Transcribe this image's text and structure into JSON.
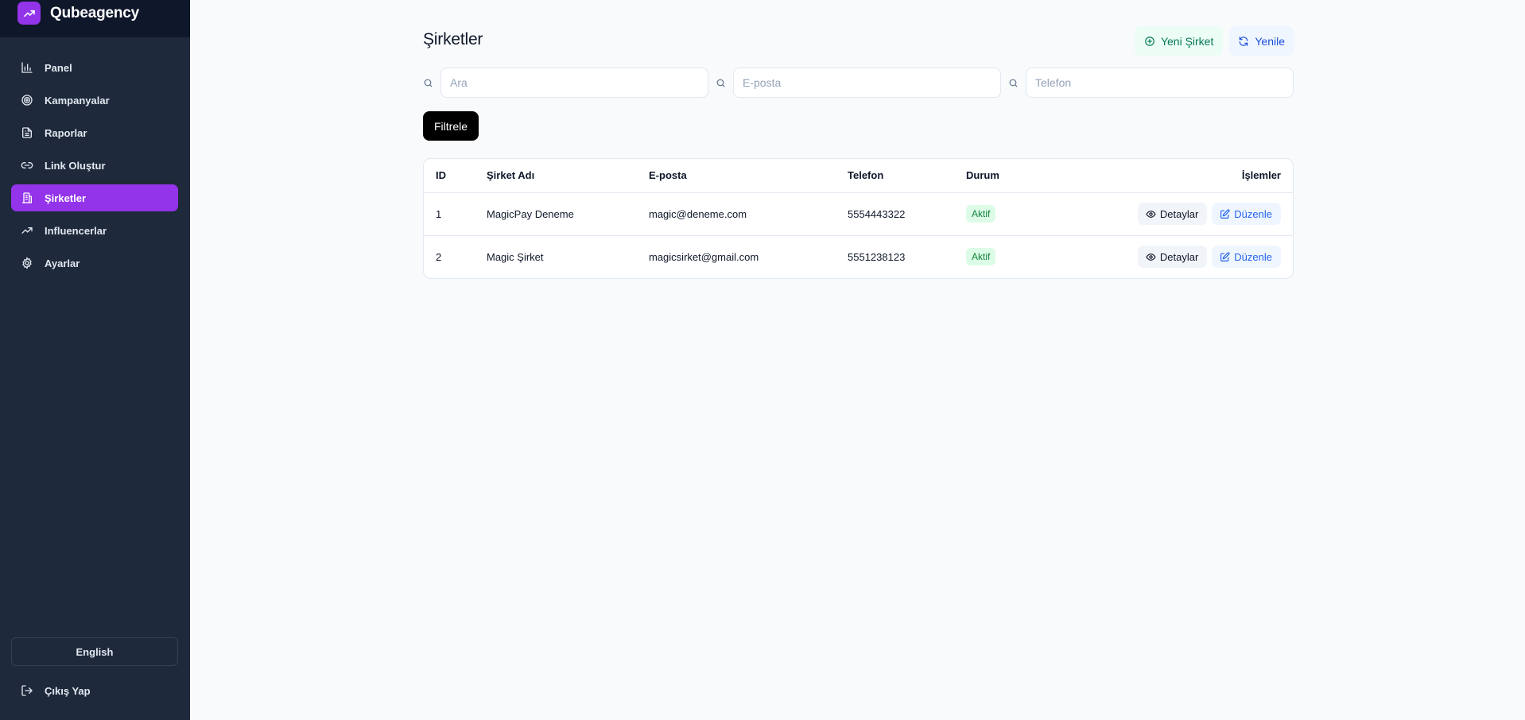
{
  "app": {
    "brand": "Qubeagency"
  },
  "sidebar": {
    "items": [
      {
        "label": "Panel",
        "icon": "bar-chart-icon",
        "active": false
      },
      {
        "label": "Kampanyalar",
        "icon": "target-icon",
        "active": false
      },
      {
        "label": "Raporlar",
        "icon": "file-text-icon",
        "active": false
      },
      {
        "label": "Link Oluştur",
        "icon": "link-icon",
        "active": false
      },
      {
        "label": "Şirketler",
        "icon": "building-icon",
        "active": true
      },
      {
        "label": "Influencerlar",
        "icon": "trending-up-icon",
        "active": false
      },
      {
        "label": "Ayarlar",
        "icon": "gear-icon",
        "active": false
      }
    ],
    "language": "English",
    "logout": "Çıkış Yap"
  },
  "main": {
    "title": "Şirketler",
    "new_company": "Yeni Şirket",
    "refresh": "Yenile",
    "filters": {
      "search_placeholder": "Ara",
      "email_placeholder": "E-posta",
      "phone_placeholder": "Telefon",
      "filter_button": "Filtrele"
    },
    "table": {
      "headers": [
        "ID",
        "Şirket Adı",
        "E-posta",
        "Telefon",
        "Durum",
        "İşlemler"
      ],
      "rows": [
        {
          "id": "1",
          "name": "MagicPay Deneme",
          "email": "magic@deneme.com",
          "phone": "5554443322",
          "status": "Aktif",
          "detail": "Detaylar",
          "edit": "Düzenle"
        },
        {
          "id": "2",
          "name": "Magic Şirket",
          "email": "magicsirket@gmail.com",
          "phone": "5551238123",
          "status": "Aktif",
          "detail": "Detaylar",
          "edit": "Düzenle"
        }
      ]
    }
  },
  "colors": {
    "sidebar_bg": "#1e293b",
    "brand_bg": "#0f172a",
    "accent": "#9333ea",
    "success": "#15803d",
    "link": "#2563eb"
  }
}
